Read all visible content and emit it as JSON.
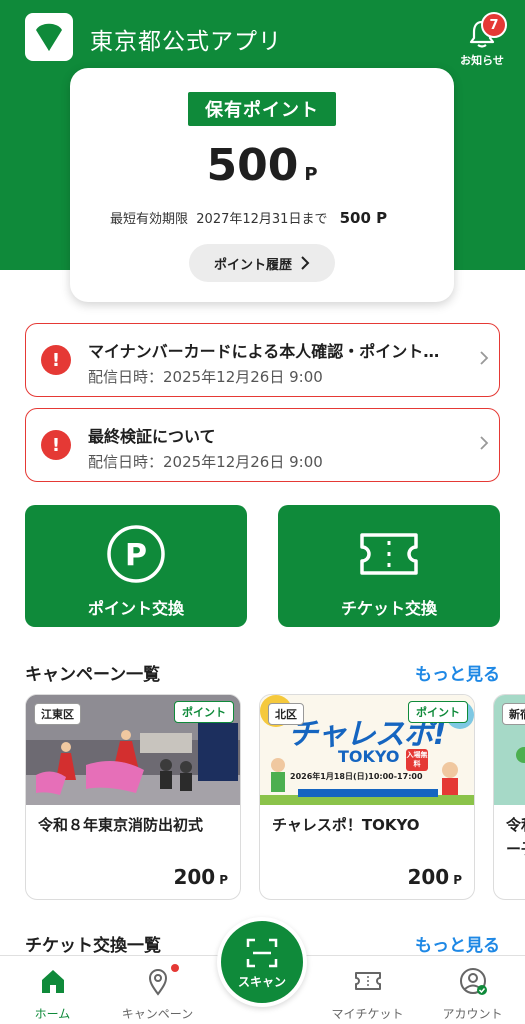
{
  "header": {
    "title": "東京都公式アプリ",
    "notifications_label": "お知らせ",
    "notifications_count": "7"
  },
  "points": {
    "tag": "保有ポイント",
    "value": "500",
    "unit": "P",
    "expiry_label": "最短有効期限",
    "expiry_date": "2027年12月31日まで",
    "expiry_points": "500 P",
    "history_label": "ポイント履歴"
  },
  "notices": [
    {
      "title": "マイナンバーカードによる本人確認・ポイント…",
      "date": "配信日時：2025年12月26日 9:00"
    },
    {
      "title": "最終検証について",
      "date": "配信日時：2025年12月26日 9:00"
    }
  ],
  "actions": {
    "point_exchange": "ポイント交換",
    "ticket_exchange": "チケット交換"
  },
  "campaigns": {
    "title": "キャンペーン一覧",
    "more": "もっと見る",
    "items": [
      {
        "ward": "江東区",
        "tag": "ポイント",
        "name": "令和８年東京消防出初式",
        "points": "200",
        "unit": "P"
      },
      {
        "ward": "北区",
        "tag": "ポイント",
        "name": "チャレスポ！TOKYO",
        "points": "200",
        "unit": "P",
        "banner_title": "チャレスポ!",
        "banner_sub": "TOKYO",
        "banner_date": "2026年1月18日(日)10:00-17:00",
        "banner_badge": "入場無料"
      },
      {
        "ward": "新宿",
        "name": "令和",
        "name_2": "ー子"
      }
    ]
  },
  "tickets": {
    "title": "チケット交換一覧",
    "more": "もっと見る"
  },
  "tabbar": {
    "home": "ホーム",
    "campaign": "キャンペーン",
    "scan": "スキャン",
    "my_ticket": "マイチケット",
    "account": "アカウント"
  },
  "colors": {
    "brand_green": "#0f8a3a",
    "alert_red": "#e53935",
    "link_blue": "#1e88e5"
  }
}
